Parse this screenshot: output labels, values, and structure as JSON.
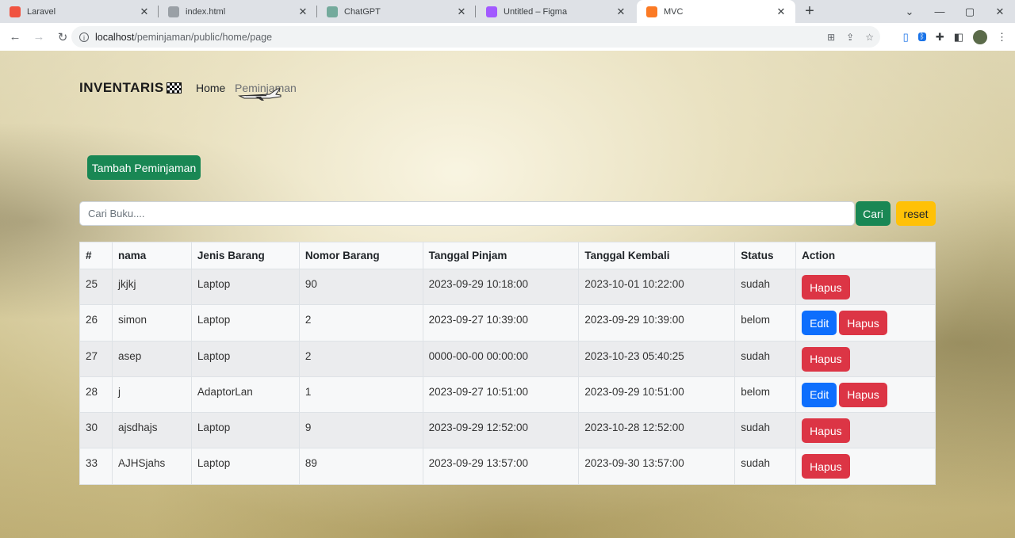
{
  "browser": {
    "tabs": [
      {
        "title": "Laravel",
        "icon": "laravel-icon",
        "color": "#f05340"
      },
      {
        "title": "index.html",
        "icon": "globe-icon",
        "color": "#9aa0a6"
      },
      {
        "title": "ChatGPT",
        "icon": "chatgpt-icon",
        "color": "#74aa9c"
      },
      {
        "title": "Untitled – Figma",
        "icon": "figma-icon",
        "color": "#a259ff"
      },
      {
        "title": "MVC",
        "icon": "xampp-icon",
        "color": "#fb7a24"
      }
    ],
    "active_tab": 4,
    "url_host": "localhost",
    "url_path": "/peminjaman/public/home/page"
  },
  "navbar": {
    "brand": "INVENTARIS",
    "links": [
      "Home",
      "Peminjaman"
    ]
  },
  "actions": {
    "add_label": "Tambah Peminjaman",
    "search_placeholder": "Cari Buku....",
    "search_value": "",
    "search_label": "Cari",
    "reset_label": "reset"
  },
  "table": {
    "headers": [
      "#",
      "nama",
      "Jenis Barang",
      "Nomor Barang",
      "Tanggal Pinjam",
      "Tanggal Kembali",
      "Status",
      "Action"
    ],
    "rows": [
      {
        "id": "25",
        "nama": "jkjkj",
        "jenis": "Laptop",
        "nomor": "90",
        "pinjam": "2023-09-29 10:18:00",
        "kembali": "2023-10-01 10:22:00",
        "status": "sudah",
        "actions": [
          "Hapus"
        ]
      },
      {
        "id": "26",
        "nama": "simon",
        "jenis": "Laptop",
        "nomor": "2",
        "pinjam": "2023-09-27 10:39:00",
        "kembali": "2023-09-29 10:39:00",
        "status": "belom",
        "actions": [
          "Edit",
          "Hapus"
        ]
      },
      {
        "id": "27",
        "nama": "asep",
        "jenis": "Laptop",
        "nomor": "2",
        "pinjam": "0000-00-00 00:00:00",
        "kembali": "2023-10-23 05:40:25",
        "status": "sudah",
        "actions": [
          "Hapus"
        ]
      },
      {
        "id": "28",
        "nama": "j",
        "jenis": "AdaptorLan",
        "nomor": "1",
        "pinjam": "2023-09-27 10:51:00",
        "kembali": "2023-09-29 10:51:00",
        "status": "belom",
        "actions": [
          "Edit",
          "Hapus"
        ]
      },
      {
        "id": "30",
        "nama": "ajsdhajs",
        "jenis": "Laptop",
        "nomor": "9",
        "pinjam": "2023-09-29 12:52:00",
        "kembali": "2023-10-28 12:52:00",
        "status": "sudah",
        "actions": [
          "Hapus"
        ]
      },
      {
        "id": "33",
        "nama": "AJHSjahs",
        "jenis": "Laptop",
        "nomor": "89",
        "pinjam": "2023-09-29 13:57:00",
        "kembali": "2023-09-30 13:57:00",
        "status": "sudah",
        "actions": [
          "Hapus"
        ]
      }
    ]
  },
  "colors": {
    "success": "#198754",
    "primary": "#0d6efd",
    "danger": "#dc3545",
    "warning": "#ffc107"
  }
}
